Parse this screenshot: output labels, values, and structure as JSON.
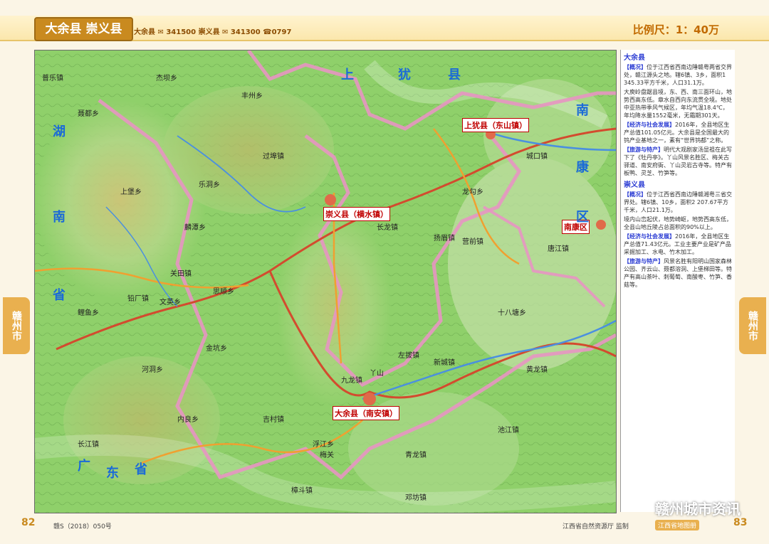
{
  "header": {
    "title": "大余县 崇义县",
    "codes": "大余县 ✉ 341500  崇义县 ✉ 341300 ☎0797",
    "scale": "比例尺：1：40万"
  },
  "side": {
    "dayu_title": "大余县",
    "dayu_overview_tag": "【概况】",
    "dayu_overview": "位于江西省西南边陲赣粤两省交界处，赣江源头之地。辖6镇、3乡，面积1 345.33平方千米，人口31.1万。",
    "dayu_overview2": "大庾岭盘踞县境，东、西、南三面环山，地势西高东低。章水自西向东流贯全境。地处中亚热带季风气候区，年均气温18.4℃，年均降水量1552毫米，无霜期301天。",
    "dayu_econ_tag": "【经济与社会发展】",
    "dayu_econ": "2016年，全县地区生产总值101.05亿元。大余县是全国最大的钨产业基地之一，素有“世界钨都”之称。",
    "dayu_tour_tag": "【旅游与特产】",
    "dayu_tour": "明代大观剧家汤显祖在此写下了《牡丹亭》。丫山风景名胜区、梅关古驿道、南安府衙、丫山灵岩古寺等。特产有板鸭、灵芝、竹笋等。",
    "chongyi_title": "崇义县",
    "chongyi_overview_tag": "【概况】",
    "chongyi_overview": "位于江西省西南边陲赣湘粤三省交界处。辖6镇、10乡，面积2 207.67平方千米，人口21.1万。",
    "chongyi_overview2": "境内山峦起伏，地势崎岖，地势西高东低，全县山地丘陵占总面积的90%以上。",
    "chongyi_econ_tag": "【经济与社会发展】",
    "chongyi_econ": "2016年，全县地区生产总值71.43亿元。工业主要产业是矿产品采掘加工、水电、竹木加工。",
    "chongyi_tour_tag": "【旅游与特产】",
    "chongyi_tour": "风景名胜有阳明山国家森林公园、齐云山、聂都溶洞、上堡梯田等。特产有高山茶叶、刺葡萄、南酸枣、竹笋、香菇等。"
  },
  "tabs": {
    "left": "赣州市",
    "right": "赣州市"
  },
  "footer": {
    "left_page": "82",
    "right_page": "83",
    "approval": "赣S（2018）050号",
    "publisher": "江西省自然资源厅 监制",
    "badge": "江西省地图册",
    "watermark": "赣州城市资讯"
  },
  "map": {
    "provinces": [
      {
        "name": "湖"
      },
      {
        "name": "南"
      },
      {
        "name": "省"
      },
      {
        "name": "广"
      },
      {
        "name": "东"
      },
      {
        "name": "省"
      },
      {
        "name": "上"
      },
      {
        "name": "犹"
      },
      {
        "name": "县"
      },
      {
        "name": "南"
      },
      {
        "name": "康"
      },
      {
        "name": "区"
      }
    ],
    "counties": [
      {
        "name": "崇义县（横水镇）"
      },
      {
        "name": "大余县（南安镇）"
      },
      {
        "name": "上犹县（东山镇）"
      },
      {
        "name": "南康区"
      }
    ],
    "places": [
      "普乐镇",
      "聂都乡",
      "关田镇",
      "铅厂镇",
      "杰坝乡",
      "过埠镇",
      "丰州乡",
      "乐洞乡",
      "麟潭乡",
      "思顺乡",
      "金坑乡",
      "上堡乡",
      "长龙镇",
      "龙勾乡",
      "扬眉镇",
      "内良乡",
      "新城镇",
      "左拔镇",
      "黄龙镇",
      "池江镇",
      "青龙镇",
      "吉村镇",
      "浮江乡",
      "河洞乡",
      "樟斗镇",
      "鲤鱼乡",
      "文英乡",
      "唐江镇",
      "十八塘乡",
      "梅关",
      "丫山",
      "营前镇",
      "长江镇",
      "九龙镇",
      "城口镇",
      "邓坊镇"
    ]
  }
}
